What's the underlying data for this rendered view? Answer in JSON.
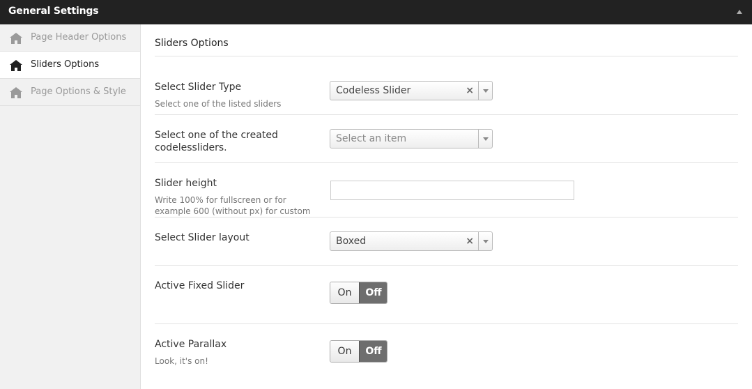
{
  "header": {
    "title": "General Settings"
  },
  "sidebar": {
    "items": [
      {
        "label": "Page Header Options"
      },
      {
        "label": "Sliders Options"
      },
      {
        "label": "Page Options & Style"
      }
    ]
  },
  "main": {
    "section_title": "Sliders Options",
    "slider_type": {
      "label": "Select Slider Type",
      "desc": "Select one of the listed sliders",
      "value": "Codeless Slider"
    },
    "codeless_slider": {
      "label_line1": "Select one of the created",
      "label_line2": "codelessliders.",
      "placeholder": "Select an item"
    },
    "slider_height": {
      "label": "Slider height",
      "desc_line1": "Write 100% for fullscreen or for",
      "desc_line2": "example 600 (without px) for custom",
      "value": ""
    },
    "slider_layout": {
      "label": "Select Slider layout",
      "value": "Boxed"
    },
    "fixed_slider": {
      "label": "Active Fixed Slider",
      "on": "On",
      "off": "Off"
    },
    "parallax": {
      "label": "Active Parallax",
      "desc": "Look, it's on!",
      "on": "On",
      "off": "Off"
    }
  },
  "colors": {
    "topbar": "#222222",
    "switch_active": "#6e6e6e",
    "sidebar_bg": "#f1f1f1"
  }
}
